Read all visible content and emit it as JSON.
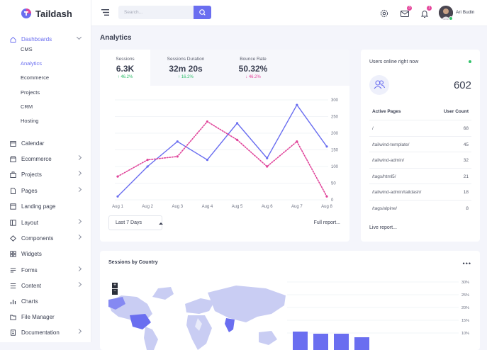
{
  "brand": {
    "name": "Taildash"
  },
  "sidebar": {
    "items": [
      {
        "label": "Dashboards",
        "icon": "home-icon",
        "open": true,
        "chevron": true
      },
      {
        "label": "Calendar",
        "icon": "calendar-icon",
        "chevron": false
      },
      {
        "label": "Ecommerce",
        "icon": "shop-icon",
        "chevron": true
      },
      {
        "label": "Projects",
        "icon": "briefcase-icon",
        "chevron": true
      },
      {
        "label": "Pages",
        "icon": "pages-icon",
        "chevron": true
      },
      {
        "label": "Landing page",
        "icon": "window-icon",
        "chevron": false
      },
      {
        "label": "Layout",
        "icon": "layout-icon",
        "chevron": true
      },
      {
        "label": "Components",
        "icon": "components-icon",
        "chevron": true
      },
      {
        "label": "Widgets",
        "icon": "widgets-icon",
        "chevron": false
      },
      {
        "label": "Forms",
        "icon": "forms-icon",
        "chevron": true
      },
      {
        "label": "Content",
        "icon": "content-icon",
        "chevron": true
      },
      {
        "label": "Charts",
        "icon": "charts-icon",
        "chevron": false
      },
      {
        "label": "File Manager",
        "icon": "folder-icon",
        "chevron": false
      },
      {
        "label": "Documentation",
        "icon": "document-icon",
        "chevron": true
      }
    ],
    "dashboard_sub": [
      "CMS",
      "Analytics",
      "Ecommerce",
      "Projects",
      "CRM",
      "Hosting"
    ],
    "active_sub": "Analytics"
  },
  "topbar": {
    "search_placeholder": "Search...",
    "messages_badge": "3",
    "notifications_badge": "1",
    "user_name": "Ari Budin"
  },
  "page": {
    "title": "Analytics"
  },
  "stats": [
    {
      "label": "Sessions",
      "value": "6.3K",
      "delta": "↑ 46.2%",
      "dir": "up"
    },
    {
      "label": "Sessions Duration",
      "value": "32m 20s",
      "delta": "↑ 16.2%",
      "dir": "up"
    },
    {
      "label": "Bounce Rate",
      "value": "50.32%",
      "delta": "↓ 46.2%",
      "dir": "down"
    }
  ],
  "chart_data": {
    "type": "line",
    "x": [
      "Aug 1",
      "Aug 2",
      "Aug 3",
      "Aug 4",
      "Aug 5",
      "Aug 6",
      "Aug 7",
      "Aug 8"
    ],
    "series": [
      {
        "values": [
          10,
          100,
          175,
          120,
          230,
          125,
          285,
          160
        ],
        "style": "solid",
        "color": "#6a6ef0"
      },
      {
        "values": [
          70,
          120,
          130,
          235,
          180,
          100,
          175,
          10
        ],
        "style": "dotted",
        "color": "#e0449a"
      }
    ],
    "ylim": [
      0,
      300
    ],
    "yticks": [
      "0",
      "50",
      "100",
      "150",
      "200",
      "250",
      "300"
    ],
    "grid": true,
    "y_axis_side": "right"
  },
  "chart_footer": {
    "select_label": "Last 7 Days",
    "full_report": "Full report..."
  },
  "online": {
    "title": "Users online right now",
    "count": "602",
    "col_page": "Active Pages",
    "col_count": "User Count",
    "rows": [
      {
        "page": "/",
        "count": "68"
      },
      {
        "page": "/tailwind-template/",
        "count": "45"
      },
      {
        "page": "/tailwind-admin/",
        "count": "32"
      },
      {
        "page": "/tags/html5/",
        "count": "21"
      },
      {
        "page": "/tailwind-admin/taildash/",
        "count": "18"
      },
      {
        "page": "/tags/alpine/",
        "count": "8"
      }
    ],
    "live_report": "Live report..."
  },
  "country": {
    "title": "Sessions by Country",
    "zoom_in": "+",
    "zoom_out": "−",
    "bar_ticks": [
      "30%",
      "25%",
      "20%",
      "15%",
      "10%"
    ]
  },
  "colors": {
    "accent": "#6a6ef0",
    "pink": "#e0449a",
    "green": "#2ebd6a"
  }
}
